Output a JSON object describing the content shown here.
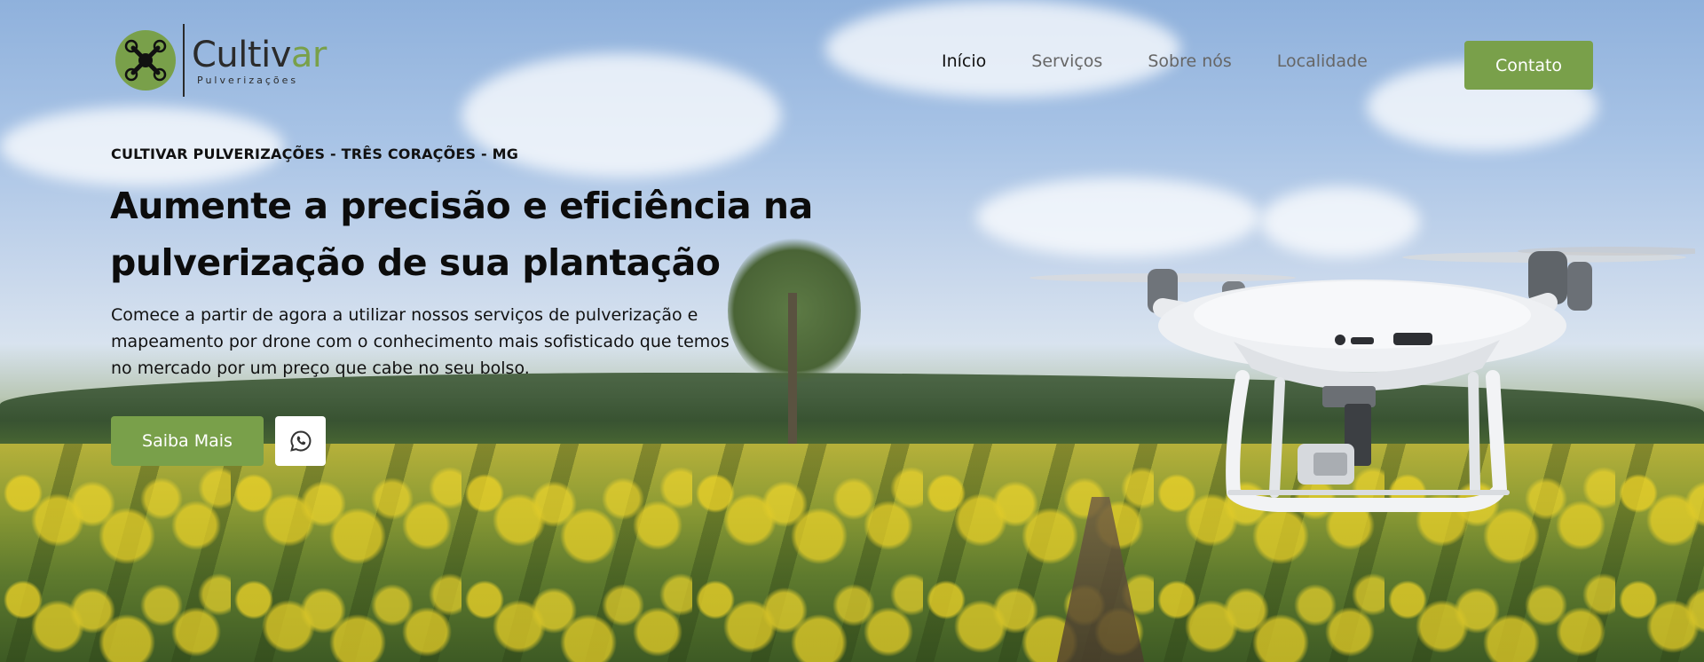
{
  "brand": {
    "name_main": "Cultiv",
    "name_accent": "ar",
    "subtitle": "Pulverizações",
    "accent_color": "#79a04a"
  },
  "nav": {
    "items": [
      {
        "label": "Início",
        "active": true
      },
      {
        "label": "Serviços",
        "active": false
      },
      {
        "label": "Sobre nós",
        "active": false
      },
      {
        "label": "Localidade",
        "active": false
      }
    ],
    "contact_label": "Contato"
  },
  "hero": {
    "eyebrow": "CULTIVAR PULVERIZAÇÕES - TRÊS CORAÇÕES - MG",
    "title_line1": "Aumente a precisão e eficiência na",
    "title_line2": "pulverização de sua plantação",
    "description_line1": "Comece a partir de agora a utilizar nossos serviços de pulverização e",
    "description_line2": "mapeamento por drone com o conhecimento mais sofisticado que temos",
    "description_line3": "no mercado por um preço que cabe no seu bolso.",
    "cta_label": "Saiba Mais",
    "whatsapp_icon": "whatsapp-icon"
  },
  "icons": {
    "logo": "drone-icon",
    "whatsapp": "whatsapp-icon"
  }
}
